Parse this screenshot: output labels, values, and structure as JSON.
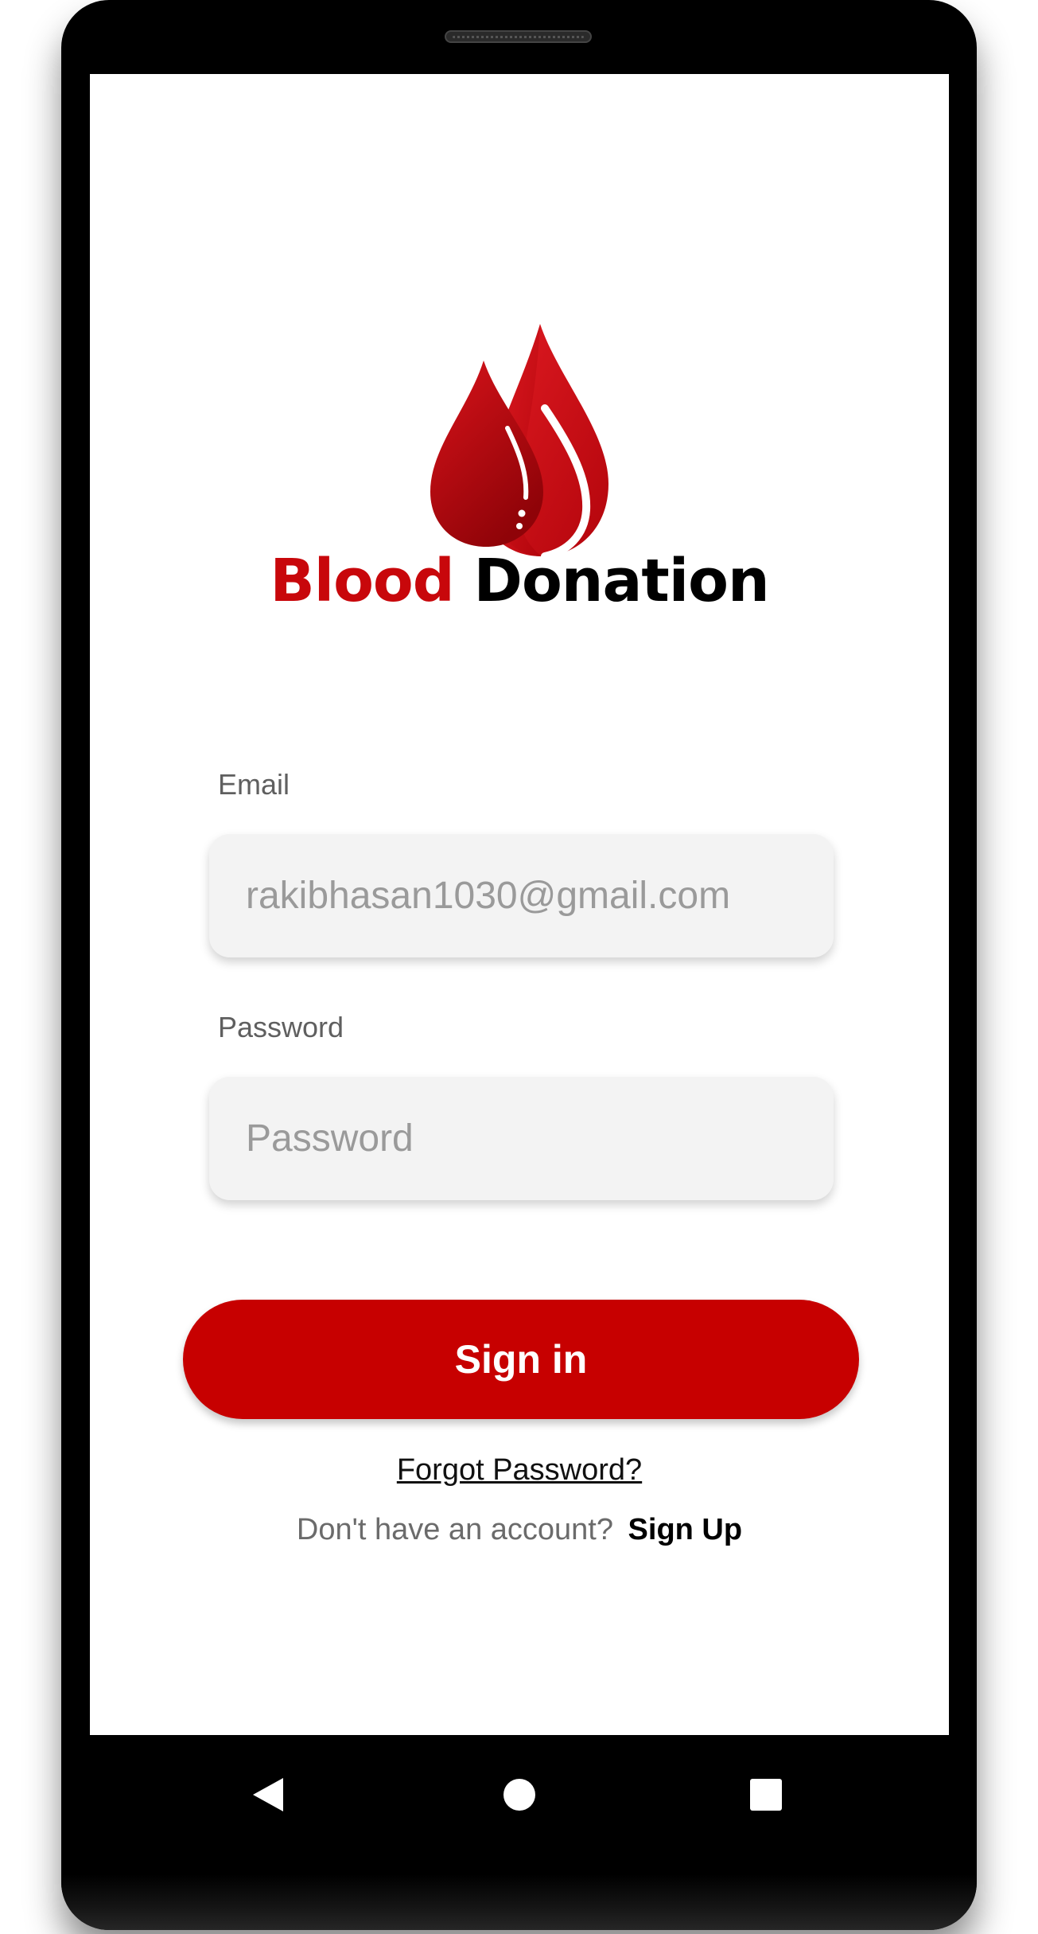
{
  "brand": {
    "word1": "Blood",
    "word2": "Donation",
    "primary_color": "#c8070b"
  },
  "form": {
    "email_label": "Email",
    "email_value": "rakibhasan1030@gmail.com",
    "password_label": "Password",
    "password_placeholder": "Password"
  },
  "actions": {
    "sign_in_label": "Sign in",
    "forgot_password_label": "Forgot Password?",
    "no_account_text": "Don't have an account?",
    "sign_up_label": "Sign Up"
  },
  "navigation": {
    "back_icon": "back-triangle-icon",
    "home_icon": "home-circle-icon",
    "recent_icon": "recent-apps-square-icon"
  },
  "colors": {
    "button_bg": "#c70000",
    "input_bg": "#f3f3f3"
  }
}
